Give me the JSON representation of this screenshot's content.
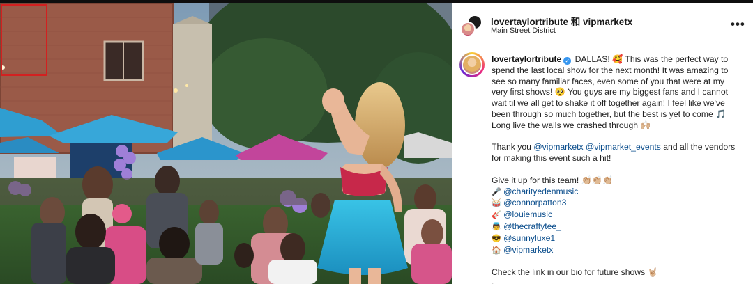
{
  "post": {
    "header": {
      "title": "lovertaylortribute 和 vipmarketx",
      "location": "Main Street District",
      "more_icon": "•••"
    },
    "caption": {
      "username": "lovertaylortribute",
      "verified_icon": "✓",
      "para1_text": " DALLAS! 🥰 This was the perfect way to spend the last local show for the next month! It was amazing to see so many familiar faces, even some of you that were at my very first shows! 🥺 You guys are my biggest fans and I cannot wait til we all get to shake it off together again! I feel like we've been through so much together, but the best is yet to come 🎵 Long live the walls we crashed through 🙌🏼",
      "thanks_prefix": "Thank you ",
      "thanks_mention1": "@vipmarketx",
      "thanks_space": " ",
      "thanks_mention2": "@vipmarket_events",
      "thanks_suffix": " and all the vendors for making this event such a hit!",
      "giveit_text": "Give it up for this team! 👏🏼👏🏼👏🏼",
      "team": [
        {
          "emoji": "🎤",
          "handle": "@charityedenmusic"
        },
        {
          "emoji": "🥁",
          "handle": "@connorpatton3"
        },
        {
          "emoji": "🎸",
          "handle": "@louiemusic"
        },
        {
          "emoji": "👼",
          "handle": "@thecraftytee_"
        },
        {
          "emoji": "😎",
          "handle": "@sunnyluxe1"
        },
        {
          "emoji": "🏠",
          "handle": "@vipmarketx"
        }
      ],
      "footer_text": "Check the link in our bio for future shows 🤘🏼",
      "trailing_dot": "."
    }
  },
  "colors": {
    "mention": "#0a4d8c",
    "verified": "#3897f0",
    "highlight_box": "#d32020"
  }
}
